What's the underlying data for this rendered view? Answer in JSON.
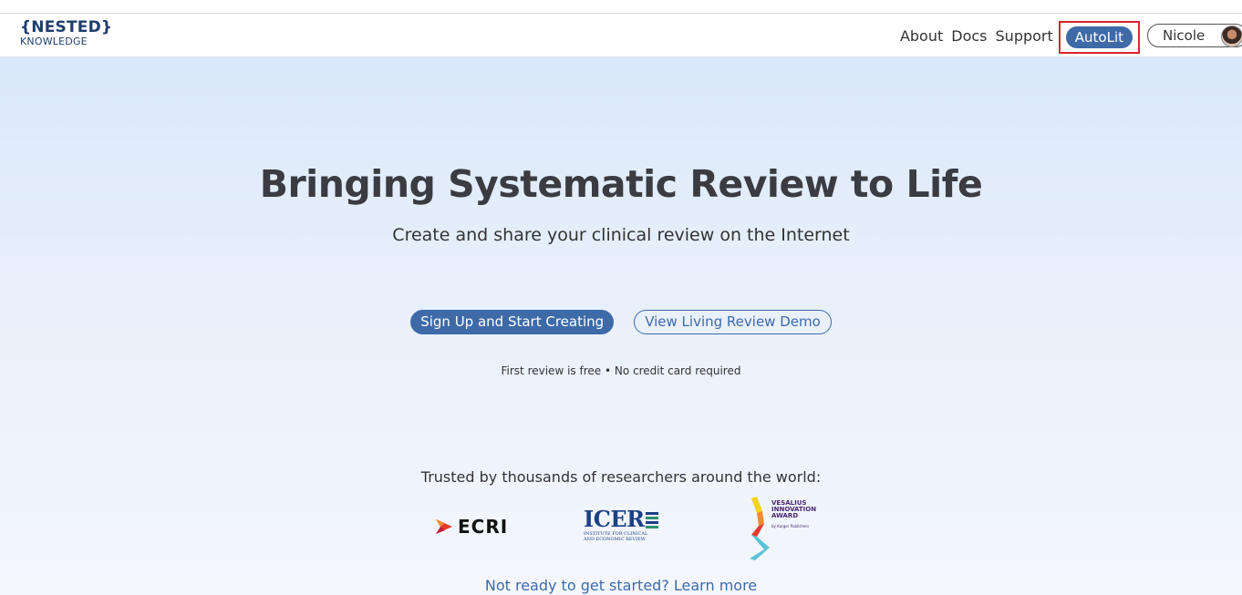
{
  "brand": {
    "logo_line1": "{NESTED}",
    "logo_line2": "KNOWLEDGE"
  },
  "nav": {
    "items": [
      {
        "label": "About"
      },
      {
        "label": "Docs"
      },
      {
        "label": "Support"
      }
    ],
    "autolit_label": "AutoLit",
    "user_name": "Nicole"
  },
  "hero": {
    "title": "Bringing Systematic Review to Life",
    "subtitle": "Create and share your clinical review on the Internet",
    "primary_cta": "Sign Up and Start Creating",
    "secondary_cta": "View Living Review Demo",
    "fineprint": "First review is free • No credit card required"
  },
  "trust": {
    "heading": "Trusted by thousands of researchers around the world:",
    "logos": {
      "ecri": "ECRI",
      "icer_name": "ICER",
      "icer_sub1": "INSTITUTE FOR CLINICAL",
      "icer_sub2": "AND ECONOMIC REVIEW",
      "vesalius_line1": "VESALIUS",
      "vesalius_line2": "INNOVATION",
      "vesalius_line3": "AWARD",
      "vesalius_sub": "by Karger Publishers"
    }
  },
  "footer": {
    "learn_more": "Not ready to get started? Learn more"
  },
  "colors": {
    "accent": "#3e6aa8",
    "highlight_border": "#d9232b",
    "brand": "#1f3d6b"
  }
}
